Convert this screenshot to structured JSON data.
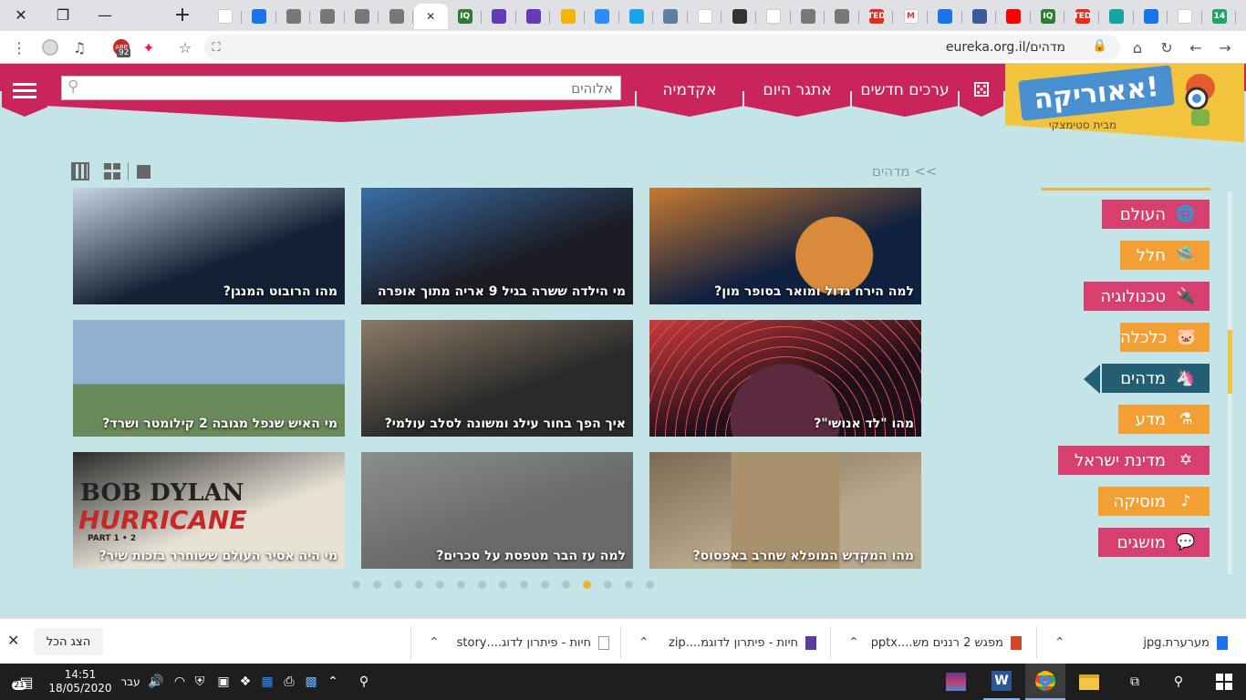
{
  "browser": {
    "window_controls": {
      "close": "✕",
      "restore": "❐",
      "minimize": "—",
      "new_tab": "+"
    },
    "tabs": [
      {
        "icon": "google-icon",
        "color": "#ffffff"
      },
      {
        "icon": "layout-icon",
        "color": "#1a73e8"
      },
      {
        "icon": "globe-icon",
        "color": "#777777"
      },
      {
        "icon": "globe-icon",
        "color": "#777777"
      },
      {
        "icon": "globe-icon",
        "color": "#777777"
      },
      {
        "icon": "globe-icon",
        "color": "#777777"
      },
      {
        "icon": "current-tab-close",
        "color": "#ffffff",
        "active": true,
        "label": "✕"
      },
      {
        "icon": "iq-icon",
        "color": "#2e7d32",
        "label": "IQ"
      },
      {
        "icon": "list-icon",
        "color": "#673ab7"
      },
      {
        "icon": "list-icon",
        "color": "#673ab7"
      },
      {
        "icon": "drive-icon",
        "color": "#f4b400"
      },
      {
        "icon": "zoom-icon",
        "color": "#2d8cff"
      },
      {
        "icon": "snowflake-icon",
        "color": "#1aa3e8"
      },
      {
        "icon": "bars-icon",
        "color": "#5c7fa3"
      },
      {
        "icon": "google-icon",
        "color": "#ffffff"
      },
      {
        "icon": "a-icon",
        "color": "#333333"
      },
      {
        "icon": "clock-icon",
        "color": "#ffffff"
      },
      {
        "icon": "globe-icon",
        "color": "#777777"
      },
      {
        "icon": "globe-icon",
        "color": "#777777"
      },
      {
        "icon": "ted-icon",
        "color": "#e62b1e",
        "label": "TED"
      },
      {
        "icon": "gmail-icon",
        "color": "#ffffff",
        "label": "M"
      },
      {
        "icon": "layout-icon",
        "color": "#1a73e8"
      },
      {
        "icon": "globe-icon",
        "color": "#3c5a99"
      },
      {
        "icon": "youtube-icon",
        "color": "#ff0000"
      },
      {
        "icon": "iq-icon",
        "color": "#2e7d32",
        "label": "IQ"
      },
      {
        "icon": "ted-icon",
        "color": "#e62b1e",
        "label": "TED"
      },
      {
        "icon": "send-icon",
        "color": "#1aa3a3"
      },
      {
        "icon": "layout-icon",
        "color": "#1a73e8"
      },
      {
        "icon": "google-icon",
        "color": "#ffffff"
      },
      {
        "icon": "counter-icon",
        "color": "#21a366",
        "label": "14"
      }
    ],
    "toolbar": {
      "url": "eureka.org.il/מדהים",
      "menu_icon": "⋮",
      "adblock_badge": "92",
      "star_icon": "☆"
    }
  },
  "site": {
    "logo": {
      "title": "אאוריקה!",
      "subtitle": "מבית סטימצקי"
    },
    "nav": {
      "new_values": "ערכים חדשים",
      "daily_challenge": "אתגר היום",
      "academy": "אקדמיה"
    },
    "search": {
      "placeholder": "אלוהים"
    },
    "breadcrumb": ">> מדהים",
    "cards": [
      {
        "caption": "למה הירח גדול ומואר בסופר מון?",
        "bg": "#10203f",
        "accent": "#c77a30"
      },
      {
        "caption": "מי הילדה ששרה בגיל 9 אריה מתוך אופרה",
        "bg": "#1c1c24",
        "accent": "#3a6fa8"
      },
      {
        "caption": "מהו הרובוט המנגן?",
        "bg": "#142033",
        "accent": "#c8d4e4"
      },
      {
        "caption": "מהו \"לד אנושי\"?",
        "bg": "#1f0f1a",
        "accent": "#c83a3a"
      },
      {
        "caption": "איך הפך בחור עילג ומשונה לסלב עולמי?",
        "bg": "#2a2a2a",
        "accent": "#8c7b66"
      },
      {
        "caption": "מי האיש שנפל מגובה 2 קילומטר ושרד?",
        "bg": "#6f93b8",
        "accent": "#9ab27a"
      },
      {
        "caption": "מהו המקדש המופלא שחרב באפסוס?",
        "bg": "#b7a88c",
        "accent": "#7a6a52"
      },
      {
        "caption": "למה עז הבר מטפסת על סכרים?",
        "bg": "#686a6a",
        "accent": "#8c8e8c"
      },
      {
        "caption": "מי היה אסיר העולם ששוחרר בזכות שיר?",
        "bg": "#e8e2d6",
        "accent": "#2a2a2a",
        "poster_title": "BOB DYLAN",
        "poster_subtitle": "HURRICANE",
        "poster_part": "PART 1 • 2"
      }
    ],
    "pager": {
      "count": 15,
      "active_index": 11
    },
    "categories": [
      {
        "label": "העולם",
        "style": "pink",
        "icon": "globe-icon",
        "glyph": "🌐"
      },
      {
        "label": "חלל",
        "style": "orange",
        "icon": "ufo-icon",
        "glyph": "🛸"
      },
      {
        "label": "טכנולוגיה",
        "style": "pink",
        "icon": "usb-icon",
        "glyph": "🔌"
      },
      {
        "label": "כלכלה",
        "style": "orange",
        "icon": "piggy-bank-icon",
        "glyph": "🐷"
      },
      {
        "label": "מדהים",
        "style": "active",
        "icon": "unicorn-icon",
        "glyph": "🦄"
      },
      {
        "label": "מדע",
        "style": "orange",
        "icon": "flask-icon",
        "glyph": "⚗"
      },
      {
        "label": "מדינת ישראל",
        "style": "pink",
        "icon": "flag-icon",
        "glyph": "✡"
      },
      {
        "label": "מוסיקה",
        "style": "orange",
        "icon": "music-note-icon",
        "glyph": "♪"
      },
      {
        "label": "מושגים",
        "style": "pink",
        "icon": "speech-bubble-icon",
        "glyph": "💬"
      }
    ]
  },
  "downloads": {
    "show_all": "הצג הכל",
    "items": [
      {
        "name": "מערערת.jpg",
        "icon": "image-file-icon"
      },
      {
        "name": "מפגש 2 רננים מש....pptx",
        "icon": "pptx-file-icon"
      },
      {
        "name": "חיות - פיתרון לדוגמ....zip",
        "icon": "zip-file-icon"
      },
      {
        "name": "חיות - פיתרון לדוג....story",
        "icon": "doc-file-icon"
      }
    ]
  },
  "taskbar": {
    "time": "14:51",
    "date": "18/05/2020",
    "lang": "עבר",
    "notifications": "21"
  }
}
